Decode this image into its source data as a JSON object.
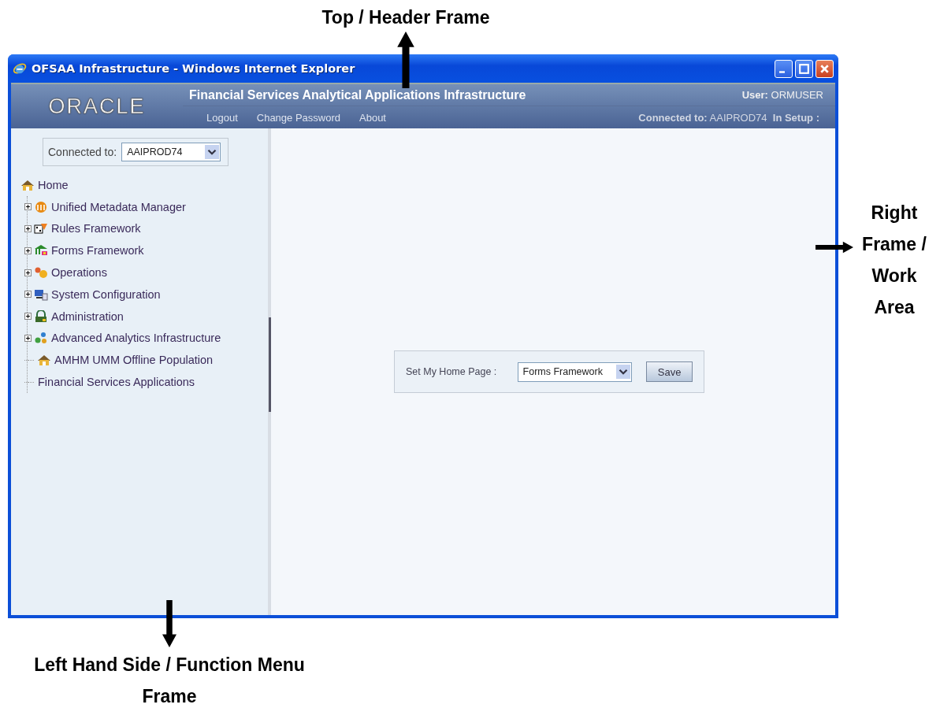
{
  "annotations": [
    {
      "text": "Top / Header Frame",
      "kind": "up"
    },
    {
      "text": "Right Frame / Work Area",
      "kind": "right"
    },
    {
      "text": "Left Hand Side / Function Menu Frame",
      "kind": "down"
    }
  ],
  "window": {
    "title": "OFSAA Infrastructure - Windows Internet Explorer"
  },
  "header": {
    "logo": "ORACLE",
    "app_title": "Financial Services Analytical Applications Infrastructure",
    "user": "**User:** ORMUSER",
    "links": [
      "Logout",
      "Change Password",
      "About"
    ],
    "connection": "**Connected to:** AAIPROD74  **In Setup :**"
  },
  "sidebar": {
    "connected_label": "Connected to:",
    "connected_value": "AAIPROD74",
    "tree": {
      "label": "Home",
      "children": [
        {
          "label": "Unified Metadata Manager",
          "kind": "node",
          "expanded": false
        },
        {
          "label": "Rules Framework",
          "kind": "node",
          "expanded": false
        },
        {
          "label": "Forms Framework",
          "kind": "node",
          "expanded": false
        },
        {
          "label": "Operations",
          "kind": "node",
          "expanded": false
        },
        {
          "label": "System Configuration",
          "kind": "node",
          "expanded": false
        },
        {
          "label": "Administration",
          "kind": "node",
          "expanded": false
        },
        {
          "label": "Advanced Analytics Infrastructure",
          "kind": "node",
          "expanded": false
        },
        {
          "label": "AMHM UMM Offline Population",
          "kind": "leaf"
        },
        {
          "label": "Financial Services Applications",
          "kind": "text"
        }
      ]
    }
  },
  "home_page": {
    "label": "Set My Home Page :",
    "value": "Forms Framework",
    "button": "Save"
  }
}
